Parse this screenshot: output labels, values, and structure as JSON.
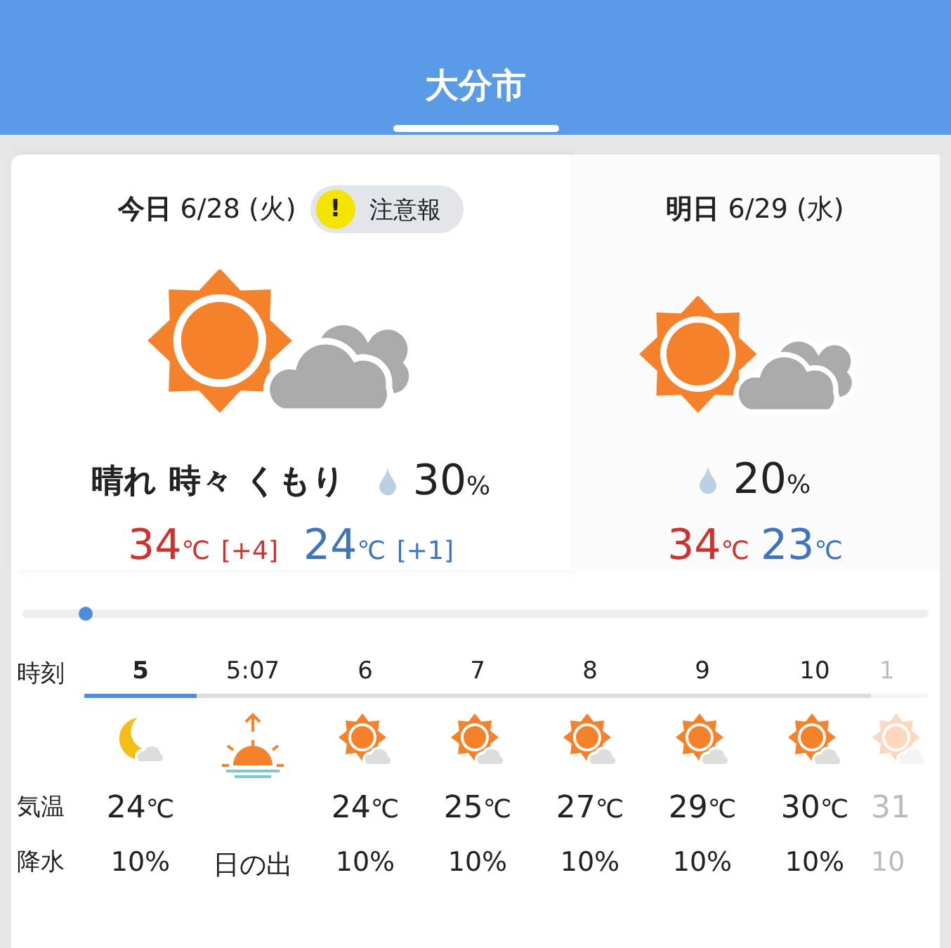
{
  "header": {
    "title": "大分市"
  },
  "days": [
    {
      "label": "今日",
      "date": "6/28 (火)",
      "selected": true,
      "warning": {
        "icon": "!",
        "label": "注意報"
      },
      "kind": "sun-cloud",
      "summary": "晴れ 時々 くもり",
      "rain": "30",
      "rain_unit": "%",
      "high": "34",
      "high_unit": "℃",
      "high_diff": "[+4]",
      "low": "24",
      "low_unit": "℃",
      "low_diff": "[+1]"
    },
    {
      "label": "明日",
      "date": "6/29 (水)",
      "selected": false,
      "kind": "sun-cloud",
      "rain": "20",
      "rain_unit": "%",
      "high": "34",
      "high_unit": "℃",
      "low": "23",
      "low_unit": "℃"
    }
  ],
  "timeline": {
    "level": 0.07
  },
  "hourly": {
    "row_labels": [
      "時刻",
      "気温",
      "降水"
    ],
    "columns": [
      {
        "time": "5",
        "selected": true,
        "kind": "moon-cloud",
        "temp": "24",
        "unit": "℃",
        "rain": "10%"
      },
      {
        "time": "5:07",
        "selected": false,
        "kind": "sunrise",
        "rain": "日の出"
      },
      {
        "time": "6",
        "selected": false,
        "kind": "sun-cloud",
        "temp": "24",
        "unit": "℃",
        "rain": "10%"
      },
      {
        "time": "7",
        "selected": false,
        "kind": "sun-cloud",
        "temp": "25",
        "unit": "℃",
        "rain": "10%"
      },
      {
        "time": "8",
        "selected": false,
        "kind": "sun-cloud",
        "temp": "27",
        "unit": "℃",
        "rain": "10%"
      },
      {
        "time": "9",
        "selected": false,
        "kind": "sun-cloud",
        "temp": "29",
        "unit": "℃",
        "rain": "10%"
      },
      {
        "time": "10",
        "selected": false,
        "kind": "sun-cloud",
        "temp": "30",
        "unit": "℃",
        "rain": "10%"
      },
      {
        "time": "1",
        "selected": false,
        "kind": "sun-cloud",
        "faded": true,
        "temp": "31",
        "rain": "10"
      }
    ]
  }
}
